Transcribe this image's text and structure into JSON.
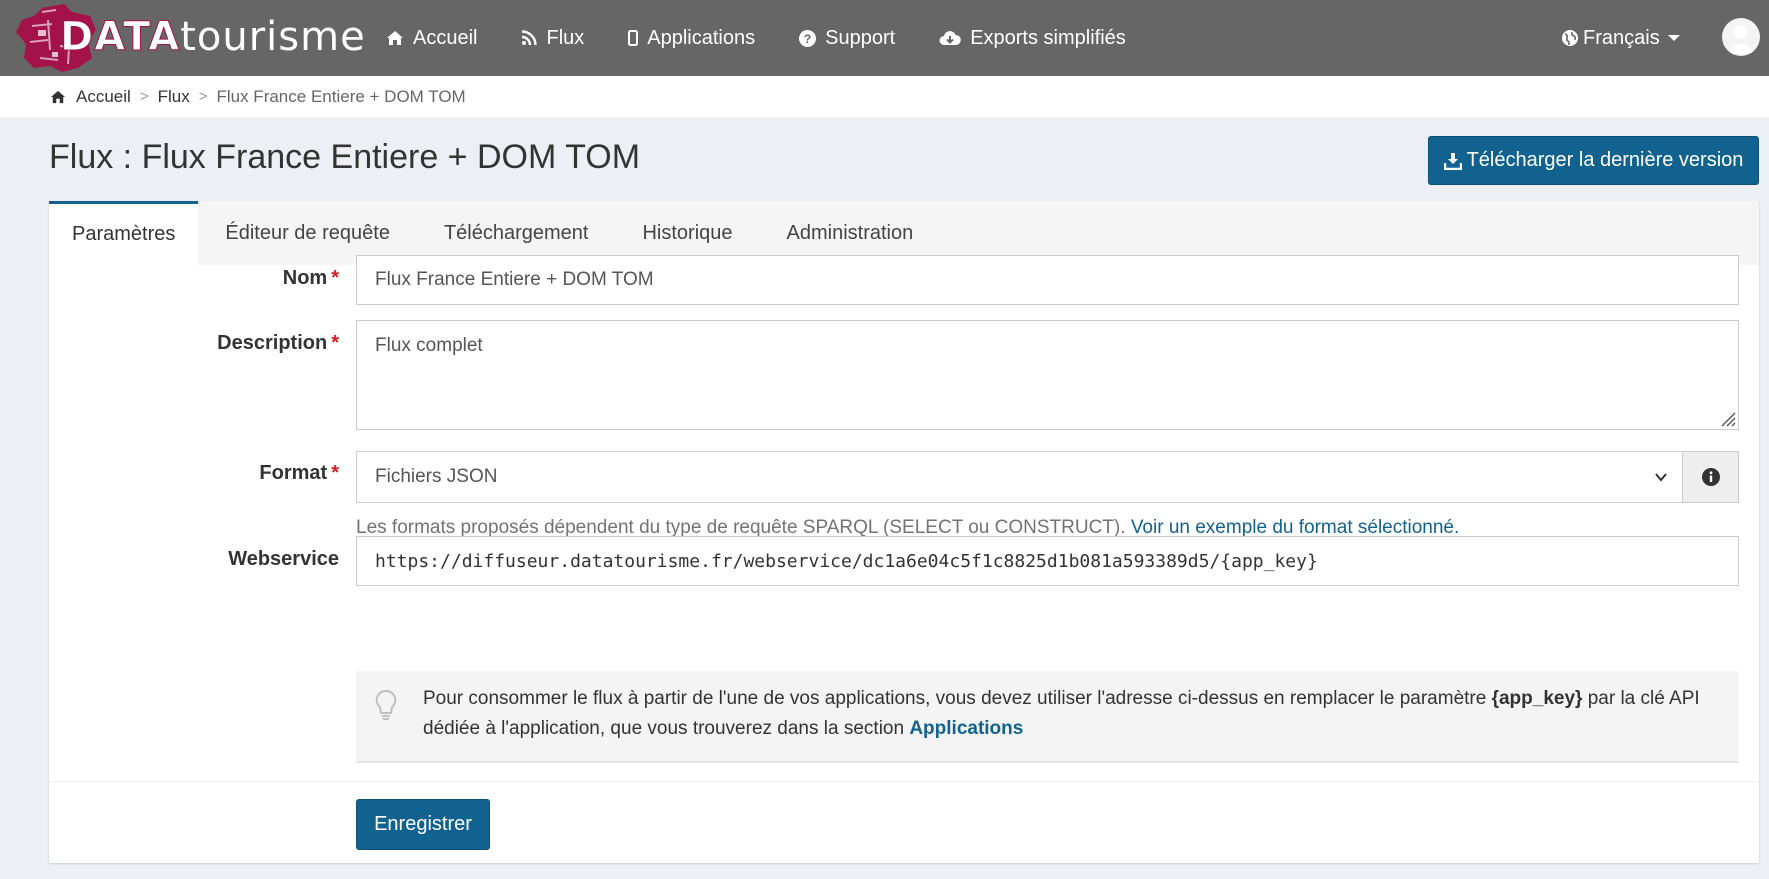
{
  "brand": {
    "logo_text_bold": "DATA",
    "logo_text_light": "tourisme"
  },
  "nav": {
    "items": [
      {
        "label": "Accueil",
        "icon": "home-icon"
      },
      {
        "label": "Flux",
        "icon": "rss-icon"
      },
      {
        "label": "Applications",
        "icon": "mobile-icon"
      },
      {
        "label": "Support",
        "icon": "question-circle-icon"
      },
      {
        "label": "Exports simplifiés",
        "icon": "cloud-download-icon"
      }
    ],
    "language": "Français"
  },
  "breadcrumb": {
    "home": "Accueil",
    "sep1": ">",
    "flux": "Flux",
    "sep2": ">",
    "current": "Flux France Entiere + DOM TOM"
  },
  "page": {
    "title": "Flux : Flux France Entiere + DOM TOM",
    "download_button": "Télécharger la dernière version"
  },
  "tabs": [
    {
      "label": "Paramètres",
      "active": true
    },
    {
      "label": "Éditeur de requête",
      "active": false
    },
    {
      "label": "Téléchargement",
      "active": false
    },
    {
      "label": "Historique",
      "active": false
    },
    {
      "label": "Administration",
      "active": false
    }
  ],
  "form": {
    "nom": {
      "label": "Nom",
      "required": "*",
      "value": "Flux France Entiere + DOM TOM"
    },
    "description": {
      "label": "Description",
      "required": "*",
      "value": "Flux complet"
    },
    "format": {
      "label": "Format",
      "required": "*",
      "value": "Fichiers JSON",
      "help": "Les formats proposés dépendent du type de requête SPARQL (SELECT ou CONSTRUCT).",
      "help_link": "Voir un exemple du format sélectionné."
    },
    "webservice": {
      "label": "Webservice",
      "value": "https://diffuseur.datatourisme.fr/webservice/dc1a6e04c5f1c8825d1b081a593389d5/{app_key}"
    },
    "callout": {
      "part1": "Pour consommer le flux à partir de l'une de vos applications, vous devez utiliser l'adresse ci-dessus en remplacer le paramètre ",
      "param": "{app_key}",
      "part2": " par la clé API dédiée à l'application, que vous trouverez dans la section ",
      "link": "Applications"
    },
    "save_button": "Enregistrer"
  },
  "colors": {
    "navbar": "#666666",
    "primary": "#12628f",
    "required": "#dd1c1c",
    "brand": "#a3134a"
  }
}
